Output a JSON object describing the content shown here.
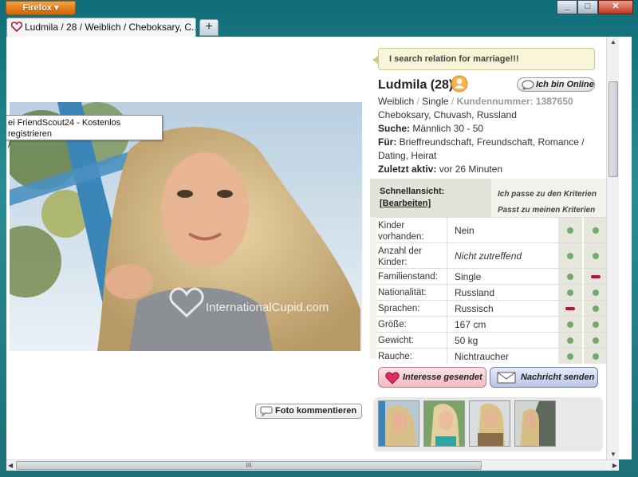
{
  "browser": {
    "menu_label": "Firefox",
    "tab_title": "Ludmila / 28 / Weiblich / Cheboksary, C...",
    "new_tab_label": "+",
    "window_buttons": {
      "minimize": "_",
      "maximize": "□",
      "close": "✕"
    }
  },
  "photo": {
    "tooltip": "ei FriendScout24 - Kostenlos registrieren",
    "tooltip_line2": "/",
    "watermark": "InternationalCupid.com",
    "comment_button": "Foto kommentieren"
  },
  "profile": {
    "headline": "I search relation for marriage!!!",
    "name": "Ludmila (28)",
    "online_button": "Ich bin Online",
    "gender": "Weiblich",
    "status": "Single",
    "customer_label": "Kundennummer: 1387650",
    "location": "Cheboksary, Chuvash, Russland",
    "search_label": "Suche:",
    "search_value": "Männlich 30 - 50",
    "for_label": "Für:",
    "for_value_1": "Brieffreundschaft, Freundschaft, Romance /",
    "for_value_2": "Dating, Heirat",
    "last_active_label": "Zuletzt aktiv:",
    "last_active_value": "vor 26 Minuten"
  },
  "criteria": {
    "quickview_label": "Schnellansicht:",
    "edit_label": "[Bearbeiten]",
    "header_1": "Ich passe zu den Kriterien",
    "header_2": "Passt zu meinen Kriterien",
    "rows": [
      {
        "label": "Kinder vorhanden:",
        "value": "Nein",
        "match1": "yes",
        "match2": "yes"
      },
      {
        "label": "Anzahl der Kinder:",
        "value": "Nicht zutreffend",
        "match1": "yes",
        "match2": "yes"
      },
      {
        "label": "Familienstand:",
        "value": "Single",
        "match1": "yes",
        "match2": "no"
      },
      {
        "label": "Nationalität:",
        "value": "Russland",
        "match1": "yes",
        "match2": "yes"
      },
      {
        "label": "Sprachen:",
        "value": "Russisch",
        "match1": "no",
        "match2": "yes"
      },
      {
        "label": "Größe:",
        "value": "167 cm",
        "match1": "yes",
        "match2": "yes"
      },
      {
        "label": "Gewicht:",
        "value": "50 kg",
        "match1": "yes",
        "match2": "yes"
      },
      {
        "label": "Rauche:",
        "value": "Nichtraucher",
        "match1": "yes",
        "match2": "yes"
      }
    ]
  },
  "actions": {
    "interest_button": "Interesse gesendet",
    "message_button": "Nachricht senden"
  },
  "colors": {
    "match_yes": "#6fae6a",
    "match_no": "#b0173c",
    "accent_orange": "#e47b14"
  },
  "scrollbar": {
    "grip": "III"
  }
}
